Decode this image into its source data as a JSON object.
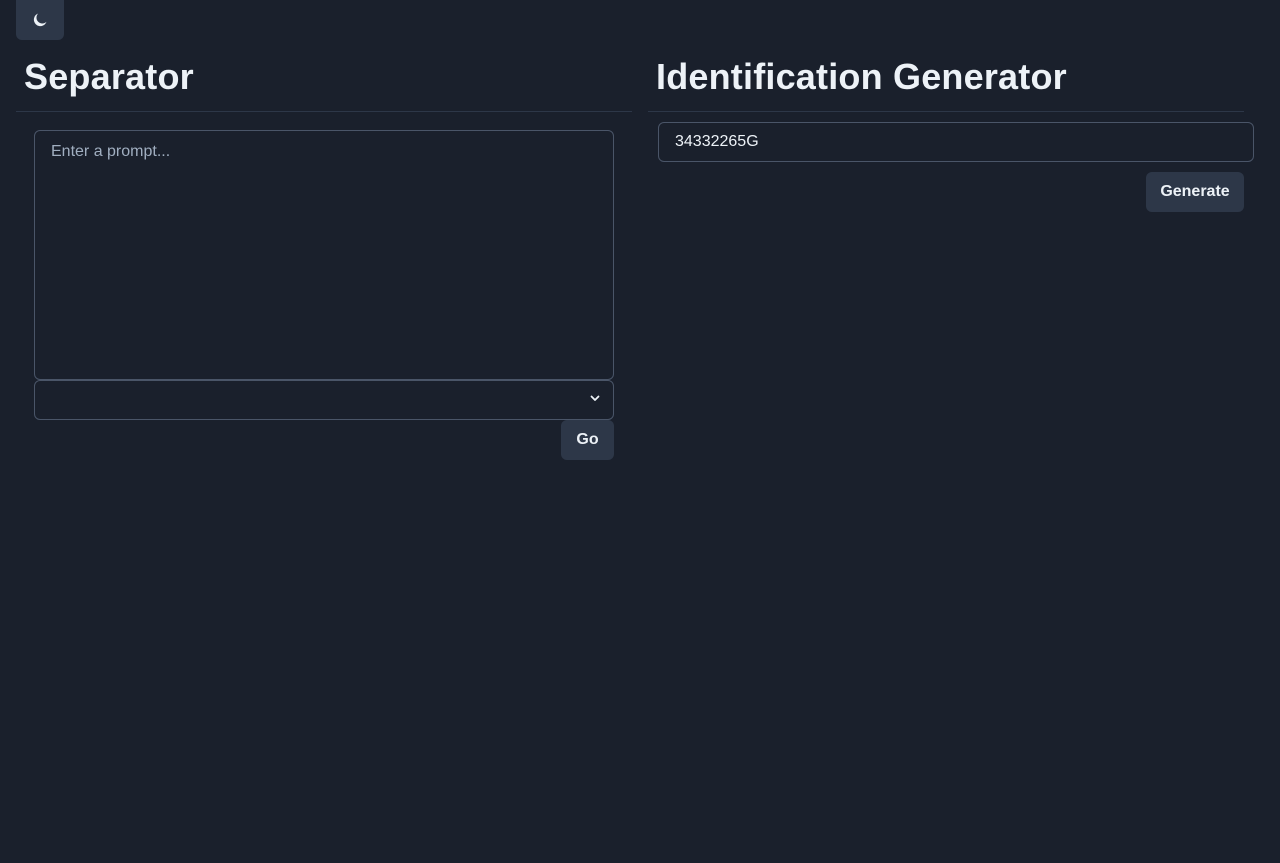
{
  "theme_toggle": {
    "icon": "moon-icon"
  },
  "separator": {
    "title": "Separator",
    "prompt_placeholder": "Enter a prompt...",
    "prompt_value": "",
    "select_value": "",
    "go_label": "Go"
  },
  "id_generator": {
    "title": "Identification Generator",
    "id_value": "34332265G",
    "generate_label": "Generate"
  },
  "colors": {
    "background": "#1a202c",
    "button_bg": "#2d3748",
    "border": "#4a5568",
    "text": "#edf2f7"
  }
}
